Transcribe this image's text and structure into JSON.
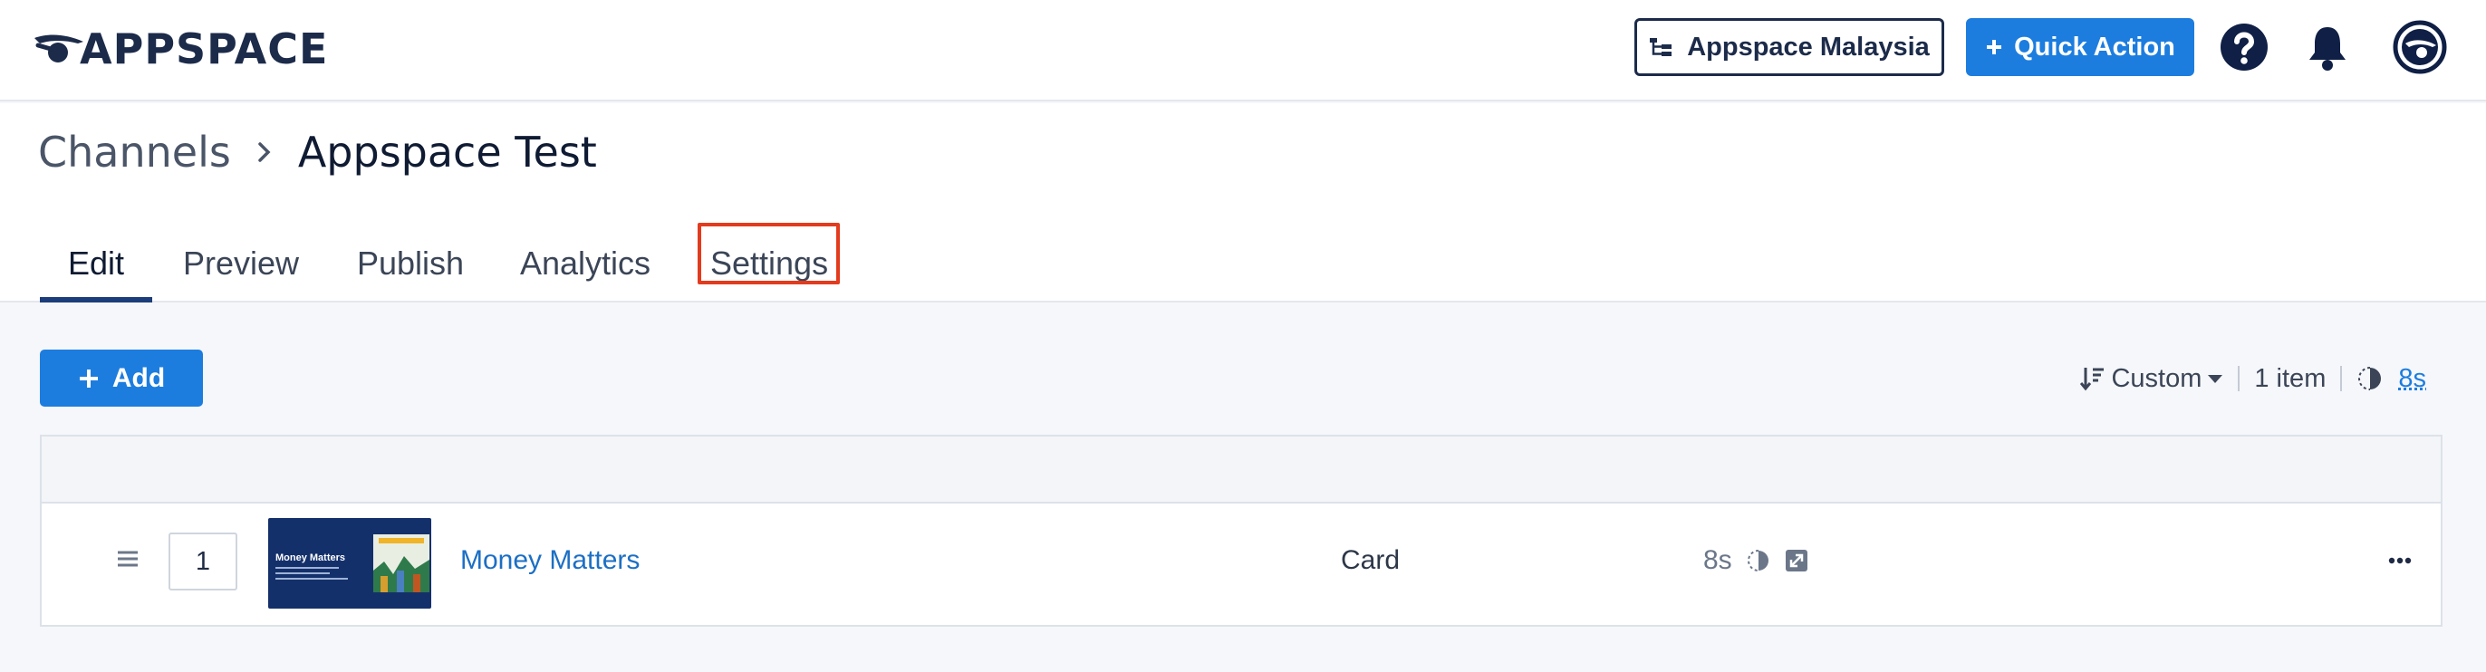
{
  "header": {
    "logo_text": "APPSPACE",
    "org_selector_label": "Appspace Malaysia",
    "quick_action_label": "Quick Action",
    "icons": [
      "logo-mark",
      "org-tree-icon",
      "plus-icon",
      "help-icon",
      "bell-icon",
      "avatar-icon"
    ]
  },
  "breadcrumb": {
    "root": "Channels",
    "current": "Appspace Test"
  },
  "tabs": [
    {
      "label": "Edit",
      "active": true
    },
    {
      "label": "Preview",
      "active": false
    },
    {
      "label": "Publish",
      "active": false
    },
    {
      "label": "Analytics",
      "active": false
    },
    {
      "label": "Settings",
      "active": false,
      "highlighted": true
    }
  ],
  "toolbar": {
    "add_label": "Add",
    "sort_label": "Custom",
    "item_count": "1 item",
    "total_duration": "8s"
  },
  "playlist": {
    "rows": [
      {
        "order": "1",
        "title": "Money Matters",
        "thumb_title": "Money Matters",
        "type": "Card",
        "duration": "8s"
      }
    ]
  },
  "colors": {
    "primary": "#1c7ddf",
    "navy": "#1c2b4a",
    "highlight": "#e23b1e"
  }
}
